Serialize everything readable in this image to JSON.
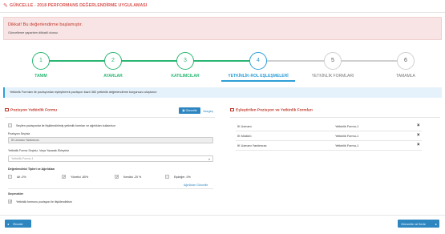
{
  "header": {
    "title": "GÜNCELLE - 2018 PERFORMANS DEĞERLENDİRME UYGULAMASI",
    "icon": "pencil-icon"
  },
  "alert": {
    "heading": "Dikkat! Bu değerlendirme başlamıştır.",
    "body": "Güncelleme yaparken dikkatli olunuz."
  },
  "steps": [
    {
      "number": "1",
      "label": "TANIM",
      "state": "done"
    },
    {
      "number": "2",
      "label": "AYARLAR",
      "state": "done"
    },
    {
      "number": "3",
      "label": "KATILIMCILAR",
      "state": "done"
    },
    {
      "number": "4",
      "label": "YETKİNLİK-ROL EŞLEŞMELERİ",
      "state": "active"
    },
    {
      "number": "5",
      "label": "YETKİNLİK FORMLARI",
      "state": "todo"
    },
    {
      "number": "6",
      "label": "TAMAMLA",
      "state": "todo"
    }
  ],
  "info_text": "Yetkinlik Formları ile pozisyonları eşleştirerek pozisyon bazlı 360 yetkinlik değerlendirme kurgunuzu oluşturun",
  "left_panel": {
    "title": "Pozisyon Yetkinlik Formu",
    "update_button": "Güncelle",
    "clear_link": "Vazgeç",
    "checkbox_all_label": "Seçilen pozisyonlar ile ilişkilendirilmiş yetkinlik formları ve ağırlıkları kullanılsın",
    "position_label": "Pozisyon Seçiniz",
    "position_value": "İK Uzmanı Yardımcısı",
    "form_label": "Yetkinlik Formu Seçiniz, Veya Yazarak Ekleyiniz",
    "form_value": "Yetkinlik Formu-1",
    "weights_label": "Değerlendirici Tipleri ve Ağırlıkları",
    "weights": [
      {
        "label": "Alt -0%",
        "checked": false
      },
      {
        "label": "Yönetici -80%",
        "checked": true
      },
      {
        "label": "Kendisi -20 %",
        "checked": true
      },
      {
        "label": "Eşdeğer -0%",
        "checked": false
      }
    ],
    "weights_update_link": "Ağırlıkları Güncelle",
    "options_label": "Seçenekler",
    "option_label": "Yetkinlik formunu pozisyon ile ilişkilendirilsin"
  },
  "right_panel": {
    "title": "Eşleştirilen Pozisyon ve Yetkinlik Formları",
    "rows": [
      {
        "position": "İK Uzmanı",
        "form": "Yetkinlik Formu-1"
      },
      {
        "position": "İK Müdürü",
        "form": "Yetkinlik Formu-1"
      },
      {
        "position": "İK Uzmanı Yardımcısı",
        "form": "Yetkinlik Formu-1"
      }
    ]
  },
  "footer": {
    "prev_label": "Önceki",
    "next_label": "Güncelle ve İlerle"
  },
  "colors": {
    "done": "#2bb673",
    "active": "#2e9fd8",
    "danger": "#c0392b",
    "primary": "#2e86c1"
  }
}
